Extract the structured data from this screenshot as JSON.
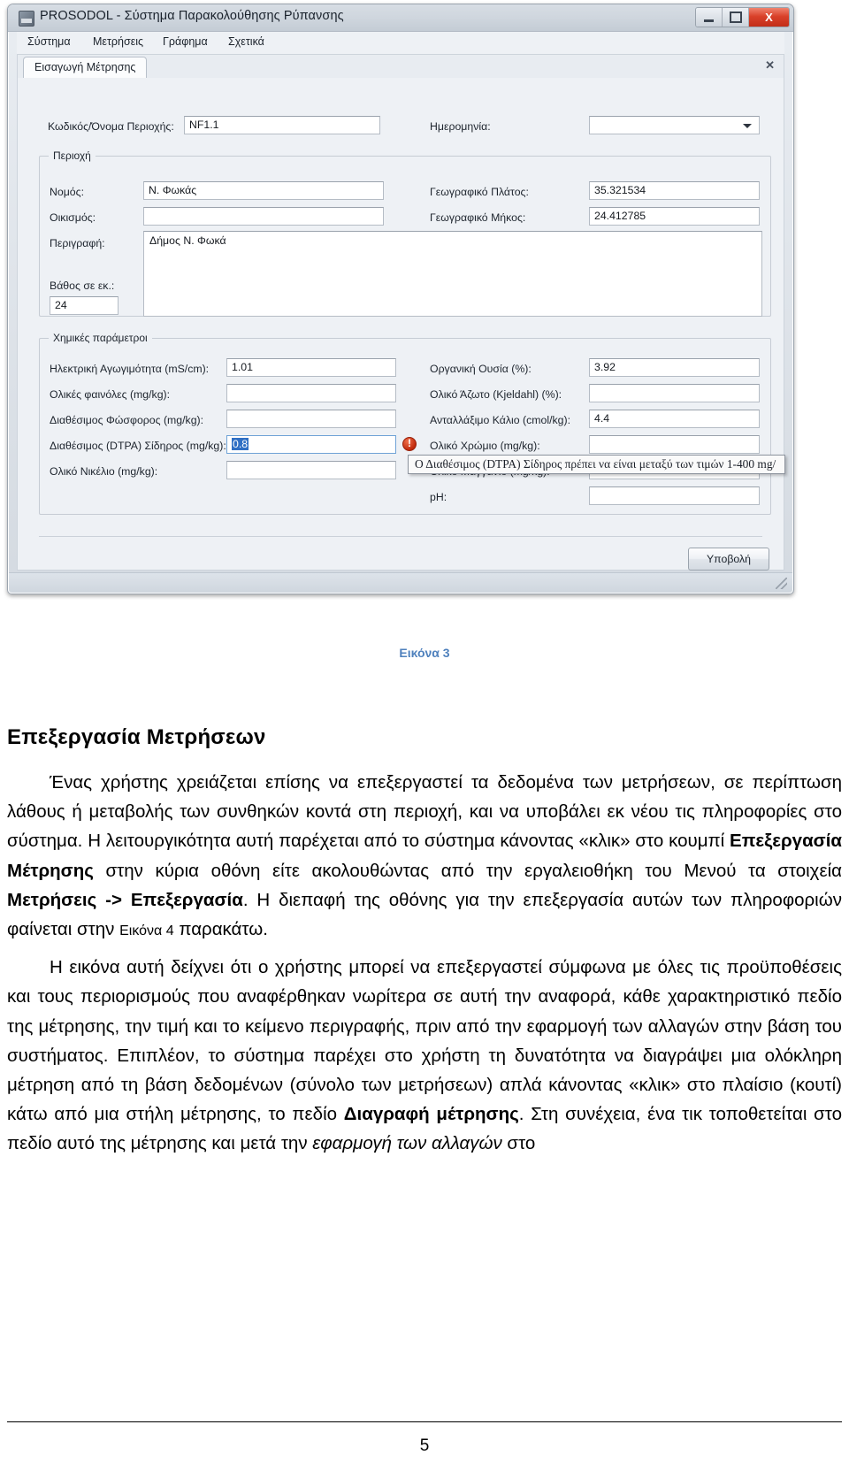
{
  "window": {
    "title": "PROSODOL - Σύστημα Παρακολούθησης Ρύπανσης",
    "icon": "app-icon",
    "controls": {
      "minimize": "minimize-icon",
      "maximize": "maximize-icon",
      "close": "X"
    },
    "menu": [
      "Σύστημα",
      "Μετρήσεις",
      "Γράφημα",
      "Σχετικά"
    ],
    "tab": {
      "label": "Εισαγωγή Μέτρησης",
      "close": "✕"
    }
  },
  "form": {
    "code_label": "Κωδικός/Όνομα Περιοχής:",
    "code_value": "NF1.1",
    "date_label": "Ημερομηνία:",
    "date_value": "",
    "area_group": "Περιοχή",
    "prefecture_label": "Νομός:",
    "prefecture_value": "Ν. Φωκάς",
    "settlement_label": "Οικισμός:",
    "settlement_value": "",
    "description_label": "Περιγραφή:",
    "description_value": "Δήμος Ν. Φωκά",
    "depth_label": "Βάθος σε εκ.:",
    "depth_value": "24",
    "latitude_label": "Γεωγραφικό Πλάτος:",
    "latitude_value": "35.321534",
    "longitude_label": "Γεωγραφικό Μήκος:",
    "longitude_value": "24.412785",
    "chem_group": "Χημικές παράμετροι",
    "chem_left": [
      {
        "label": "Ηλεκτρική Αγωγιμότητα (mS/cm):",
        "value": "1.01"
      },
      {
        "label": "Ολικές φαινόλες (mg/kg):",
        "value": ""
      },
      {
        "label": "Διαθέσιμος Φώσφορος (mg/kg):",
        "value": ""
      },
      {
        "label": "Διαθέσιμος (DTPA) Σίδηρος (mg/kg):",
        "value": "0.8"
      },
      {
        "label": "Ολικό Νικέλιο (mg/kg):",
        "value": ""
      }
    ],
    "chem_right": [
      {
        "label": "Οργανική Ουσία (%):",
        "value": "3.92"
      },
      {
        "label": "Ολικό Άζωτο (Kjeldahl) (%):",
        "value": ""
      },
      {
        "label": "Ανταλλάξιμο Κάλιο (cmol/kg):",
        "value": "4.4"
      },
      {
        "label": "Ολικό Χρώμιο (mg/kg):",
        "value": ""
      },
      {
        "label": "Ολικό Μαγγάνιο (mg/kg):",
        "value": ""
      },
      {
        "label": "pH:",
        "value": ""
      }
    ],
    "error_icon": "error-icon",
    "tooltip": "Ο Διαθέσιμος (DTPA) Σίδηρος πρέπει να είναι μεταξύ των τιμών 1-400 mg/",
    "submit_label": "Υποβολή"
  },
  "document": {
    "figure_caption": "Εικόνα 3",
    "heading": "Επεξεργασία Μετρήσεων",
    "para1_a": "Ένας χρήστης χρειάζεται επίσης να επεξεργαστεί τα δεδομένα των μετρήσεων, σε περίπτωση λάθους ή μεταβολής των συνθηκών κοντά στη περιοχή, και να υποβάλει εκ νέου τις πληροφορίες στο σύστημα. Η λειτουργικότητα αυτή παρέχεται από το σύστημα κάνοντας «κλικ» στο κουμπί ",
    "para1_b": "Επεξεργασία Μέτρησης",
    "para1_c": " στην κύρια οθόνη είτε ακολουθώντας από την εργαλειοθήκη του Μενού τα στοιχεία ",
    "para1_d": "Μετρήσεις -> Επεξεργασία",
    "para1_e": ". Η διεπαφή της οθόνης για την επεξεργασία αυτών των πληροφοριών φαίνεται στην ",
    "para1_f": "Εικόνα 4",
    "para1_g": " παρακάτω.",
    "para2_a": "Η εικόνα αυτή δείχνει ότι ο χρήστης μπορεί να επεξεργαστεί σύμφωνα με όλες τις προϋποθέσεις και τους περιορισμούς που αναφέρθηκαν νωρίτερα σε αυτή την αναφορά, κάθε χαρακτηριστικό πεδίο της μέτρησης, την τιμή και το κείμενο περιγραφής, πριν από την εφαρμογή των αλλαγών στην βάση του συστήματος. Επιπλέον, το σύστημα παρέχει στο χρήστη τη δυνατότητα να διαγράψει μια ολόκληρη μέτρηση από τη βάση δεδομένων (σύνολο των μετρήσεων) απλά κάνοντας «κλικ» στο πλαίσιο (κουτί) κάτω από μια στήλη μέτρησης, το πεδίο ",
    "para2_b": "Διαγραφή μέτρησης",
    "para2_c": ". Στη συνέχεια, ένα τικ τοποθετείται στο πεδίο αυτό της μέτρησης και μετά την ",
    "para2_d": "εφαρμογή των αλλαγών",
    "para2_e": " στο",
    "page_number": "5"
  }
}
